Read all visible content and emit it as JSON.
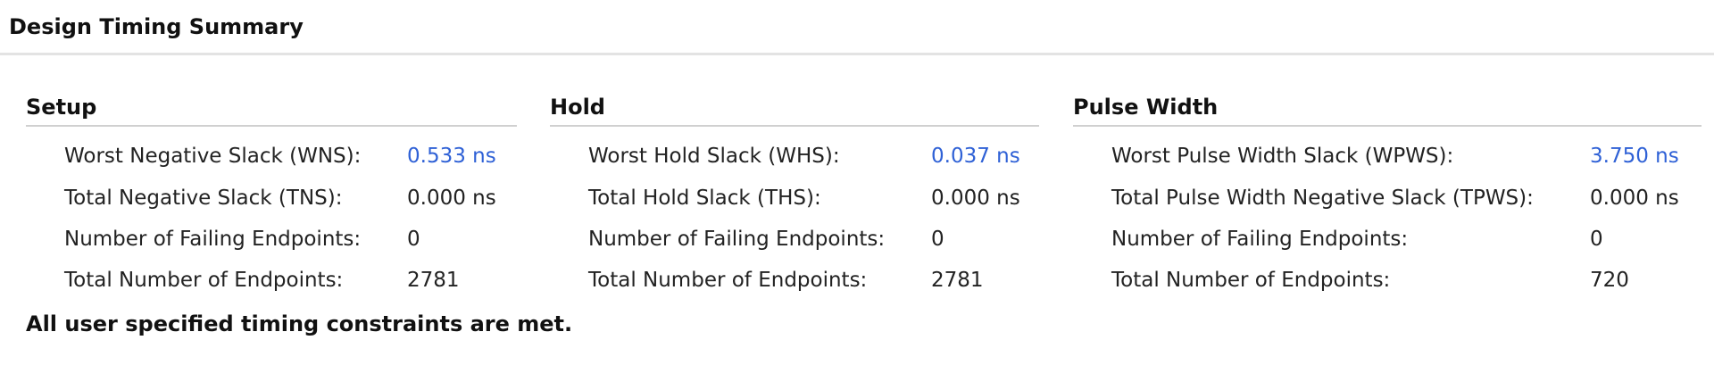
{
  "title": "Design Timing Summary",
  "colors": {
    "link": "#2f61d6",
    "text": "#222222",
    "divider": "#d0d0d0"
  },
  "sections": {
    "setup": {
      "title": "Setup",
      "rows": [
        {
          "label": "Worst Negative Slack (WNS):",
          "value": "0.533 ns"
        },
        {
          "label": "Total Negative Slack (TNS):",
          "value": "0.000 ns"
        },
        {
          "label": "Number of Failing Endpoints:",
          "value": "0"
        },
        {
          "label": "Total Number of Endpoints:",
          "value": "2781"
        }
      ]
    },
    "hold": {
      "title": "Hold",
      "rows": [
        {
          "label": "Worst Hold Slack (WHS):",
          "value": "0.037 ns"
        },
        {
          "label": "Total Hold Slack (THS):",
          "value": "0.000 ns"
        },
        {
          "label": "Number of Failing Endpoints:",
          "value": "0"
        },
        {
          "label": "Total Number of Endpoints:",
          "value": "2781"
        }
      ]
    },
    "pulse_width": {
      "title": "Pulse Width",
      "rows": [
        {
          "label": "Worst Pulse Width Slack (WPWS):",
          "value": "3.750 ns"
        },
        {
          "label": "Total Pulse Width Negative Slack (TPWS):",
          "value": "0.000 ns"
        },
        {
          "label": "Number of Failing Endpoints:",
          "value": "0"
        },
        {
          "label": "Total Number of Endpoints:",
          "value": "720"
        }
      ]
    }
  },
  "footer": "All user specified timing constraints are met."
}
